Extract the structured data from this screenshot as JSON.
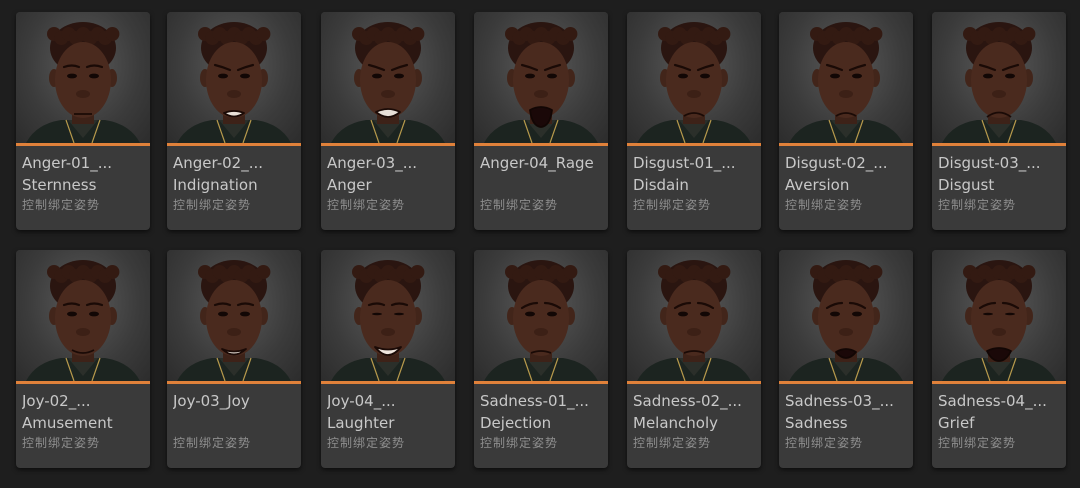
{
  "assets": [
    {
      "line1": "Anger-01_...",
      "line2": "Sternness",
      "type_label": "控制绑定姿势",
      "expression": "neutral-stern",
      "thumbnail": "face-portrait-icon"
    },
    {
      "line1": "Anger-02_...",
      "line2": "Indignation",
      "type_label": "控制绑定姿势",
      "expression": "teeth",
      "thumbnail": "face-portrait-icon"
    },
    {
      "line1": "Anger-03_...",
      "line2": "Anger",
      "type_label": "控制绑定姿势",
      "expression": "snarl",
      "thumbnail": "face-portrait-icon"
    },
    {
      "line1": "Anger-04_Rage",
      "line2": "",
      "type_label": "控制绑定姿势",
      "expression": "shout",
      "thumbnail": "face-portrait-icon"
    },
    {
      "line1": "Disgust-01_...",
      "line2": "Disdain",
      "type_label": "控制绑定姿势",
      "expression": "frown",
      "thumbnail": "face-portrait-icon"
    },
    {
      "line1": "Disgust-02_...",
      "line2": "Aversion",
      "type_label": "控制绑定姿势",
      "expression": "frown",
      "thumbnail": "face-portrait-icon"
    },
    {
      "line1": "Disgust-03_...",
      "line2": "Disgust",
      "type_label": "控制绑定姿势",
      "expression": "grimace",
      "thumbnail": "face-portrait-icon"
    },
    {
      "line1": "Joy-02_...",
      "line2": "Amusement",
      "type_label": "控制绑定姿势",
      "expression": "smile-soft",
      "thumbnail": "face-portrait-icon"
    },
    {
      "line1": "Joy-03_Joy",
      "line2": "",
      "type_label": "控制绑定姿势",
      "expression": "smile",
      "thumbnail": "face-portrait-icon"
    },
    {
      "line1": "Joy-04_...",
      "line2": "Laughter",
      "type_label": "控制绑定姿势",
      "expression": "laugh",
      "thumbnail": "face-portrait-icon"
    },
    {
      "line1": "Sadness-01_...",
      "line2": "Dejection",
      "type_label": "控制绑定姿势",
      "expression": "sad-soft",
      "thumbnail": "face-portrait-icon"
    },
    {
      "line1": "Sadness-02_...",
      "line2": "Melancholy",
      "type_label": "控制绑定姿势",
      "expression": "sad-soft",
      "thumbnail": "face-portrait-icon"
    },
    {
      "line1": "Sadness-03_...",
      "line2": "Sadness",
      "type_label": "控制绑定姿势",
      "expression": "sad-open",
      "thumbnail": "face-portrait-icon"
    },
    {
      "line1": "Sadness-04_...",
      "line2": "Grief",
      "type_label": "控制绑定姿势",
      "expression": "cry",
      "thumbnail": "face-portrait-icon"
    }
  ],
  "colors": {
    "background": "#1e1e1e",
    "card": "#3a3a3a",
    "accent": "#e0813a",
    "text": "#c8c8c8",
    "subtext": "#8e8e8e",
    "skin": "#4a2a1e",
    "hair": "#2a1510"
  }
}
